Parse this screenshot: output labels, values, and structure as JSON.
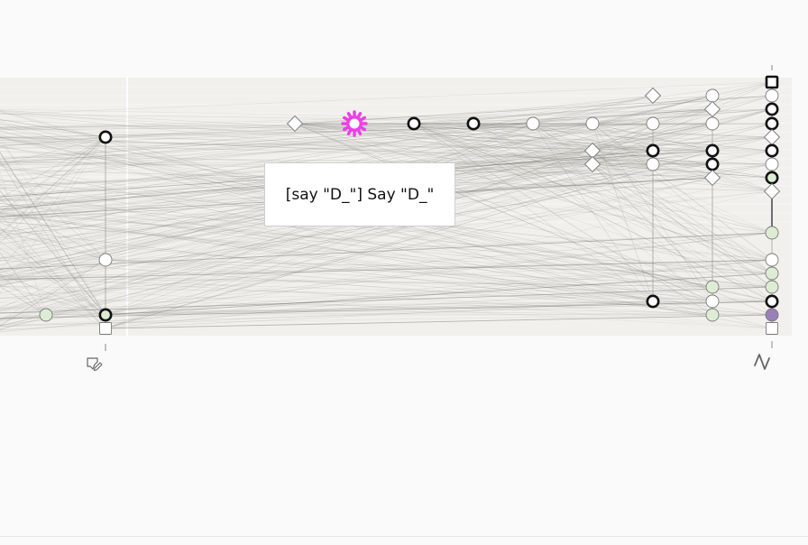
{
  "colors": {
    "page_background": "#fafafa",
    "panel_background": "#f1f0ec",
    "edge": "#8a8a84",
    "node_fill_default": "#ffffff",
    "node_fill_green": "#dcedd4",
    "node_fill_purple": "#9b7fb8",
    "highlight_magenta": "#ee3ee8",
    "outline_bold": "#111111"
  },
  "tooltip": {
    "text": "[say \"D_\"] Say \"D_\""
  },
  "axis_icons": {
    "left": "hand-pointer-pencil-icon",
    "right": "letter-n-icon"
  },
  "highlighted_node_icon": "gear-icon"
}
